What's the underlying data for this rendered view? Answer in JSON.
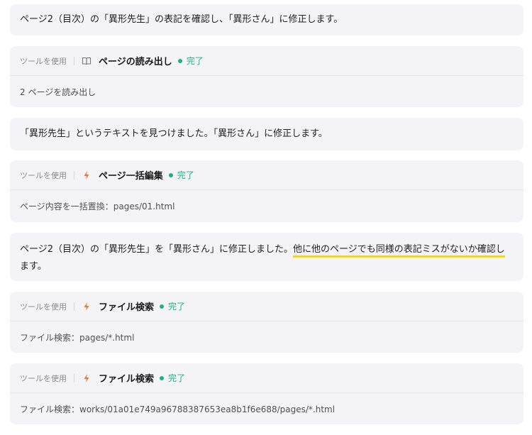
{
  "colors": {
    "card_bg": "#f4f4f6",
    "success": "#1bb37c",
    "highlight": "#f5d90a",
    "bolt": "#e8773a"
  },
  "messages": {
    "m1": "ページ2（目次）の「異形先生」の表記を確認し、「異形さん」に修正します。",
    "m2": "「異形先生」というテキストを見つけました。「異形さん」に修正します。",
    "m3_before": "ページ2（目次）の「異形先生」を「異形さん」に修正しました。",
    "m3_highlight": "他に他のページでも同様の表記ミスがないか確認し",
    "m3_after": "ます。"
  },
  "tools": [
    {
      "label": "ツールを使用",
      "icon": "book-icon",
      "name": "ページの読み出し",
      "status": "完了",
      "detail": "2 ページを読み出し"
    },
    {
      "label": "ツールを使用",
      "icon": "bolt-icon",
      "name": "ページ一括編集",
      "status": "完了",
      "detail": "ページ内容を一括置換：pages/01.html"
    },
    {
      "label": "ツールを使用",
      "icon": "bolt-icon",
      "name": "ファイル検索",
      "status": "完了",
      "detail": "ファイル検索：pages/*.html"
    },
    {
      "label": "ツールを使用",
      "icon": "bolt-icon",
      "name": "ファイル検索",
      "status": "完了",
      "detail": "ファイル検索：works/01a01e749a96788387653ea8b1f6e688/pages/*.html"
    }
  ]
}
